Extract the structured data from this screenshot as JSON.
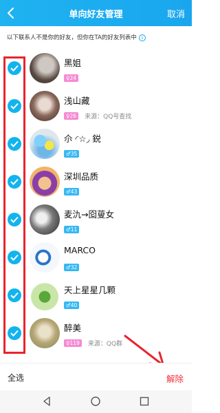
{
  "header": {
    "title": "单向好友管理",
    "cancel_label": "取消"
  },
  "notice": "以下联系人不是你的好友，但你在TA的好友列表中",
  "contacts": [
    {
      "name": "黑姐",
      "gender": "f",
      "age": "24",
      "source": ""
    },
    {
      "name": "浅山藏",
      "gender": "f",
      "age": "26",
      "source": "来源：QQ号查找"
    },
    {
      "name": "尒 ◜☆◞ 鋭",
      "gender": "m",
      "age": "35",
      "source": ""
    },
    {
      "name": "深圳品质",
      "gender": "m",
      "age": "43",
      "source": ""
    },
    {
      "name": "麦氿→囵蓃女",
      "gender": "m",
      "age": "11",
      "source": ""
    },
    {
      "name": "MARCO",
      "gender": "m",
      "age": "32",
      "source": ""
    },
    {
      "name": "天上星星几颗",
      "gender": "m",
      "age": "40",
      "source": ""
    },
    {
      "name": "醉美",
      "gender": "f",
      "age": "119",
      "source": "来源：QQ群"
    }
  ],
  "bottom": {
    "select_all_label": "全选",
    "remove_label": "解除"
  },
  "colors": {
    "accent": "#12b4ee",
    "danger": "#f2323e",
    "annotation": "#e8242e"
  },
  "icons": [
    "back-icon",
    "check-icon",
    "info-icon",
    "female-icon",
    "male-icon",
    "nav-back-icon",
    "nav-home-icon",
    "nav-recent-icon"
  ]
}
